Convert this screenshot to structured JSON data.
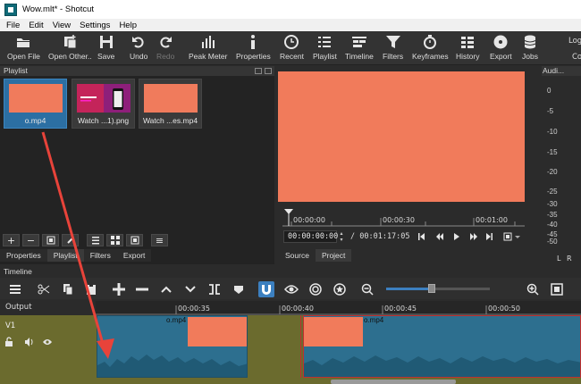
{
  "window": {
    "title": "Wow.mlt* - Shotcut"
  },
  "menu": [
    "File",
    "Edit",
    "View",
    "Settings",
    "Help"
  ],
  "toolbar": {
    "open_file": "Open File",
    "open_other": "Open Other..",
    "save": "Save",
    "undo": "Undo",
    "redo": "Redo",
    "peak_meter": "Peak Meter",
    "properties": "Properties",
    "recent": "Recent",
    "playlist": "Playlist",
    "timeline": "Timeline",
    "filters": "Filters",
    "keyframes": "Keyframes",
    "history": "History",
    "export": "Export",
    "jobs": "Jobs",
    "log": "Log",
    "co": "Co"
  },
  "playlist": {
    "title": "Playlist",
    "items": [
      {
        "caption": "o.mp4"
      },
      {
        "caption": "Watch ...1).png"
      },
      {
        "caption": "Watch ...es.mp4"
      }
    ],
    "tabs": [
      "Properties",
      "Playlist",
      "Filters",
      "Export"
    ]
  },
  "player": {
    "ruler": [
      "00:00:00",
      "00:00:30",
      "00:01:00"
    ],
    "current_timecode": "00:00:00:00",
    "total_timecode": "/ 00:01:17:05",
    "tabs": [
      "Source",
      "Project"
    ]
  },
  "audio": {
    "title": "Audi...",
    "scale": [
      "0",
      "-5",
      "-10",
      "-15",
      "-20",
      "-25",
      "-30",
      "-35",
      "-40",
      "-45",
      "-50"
    ],
    "left": "L",
    "right": "R"
  },
  "timeline": {
    "title": "Timeline",
    "output_label": "Output",
    "track_name": "V1",
    "ruler": [
      "00:00:35",
      "00:00:40",
      "00:00:45",
      "00:00:50"
    ],
    "clips": [
      {
        "label": "o.mp4"
      },
      {
        "label": "o.mp4"
      }
    ]
  },
  "colors": {
    "accent": "#f17b5b",
    "clip": "#2d6f8f",
    "track": "#6b6b2e",
    "arrow": "#e8433a"
  }
}
